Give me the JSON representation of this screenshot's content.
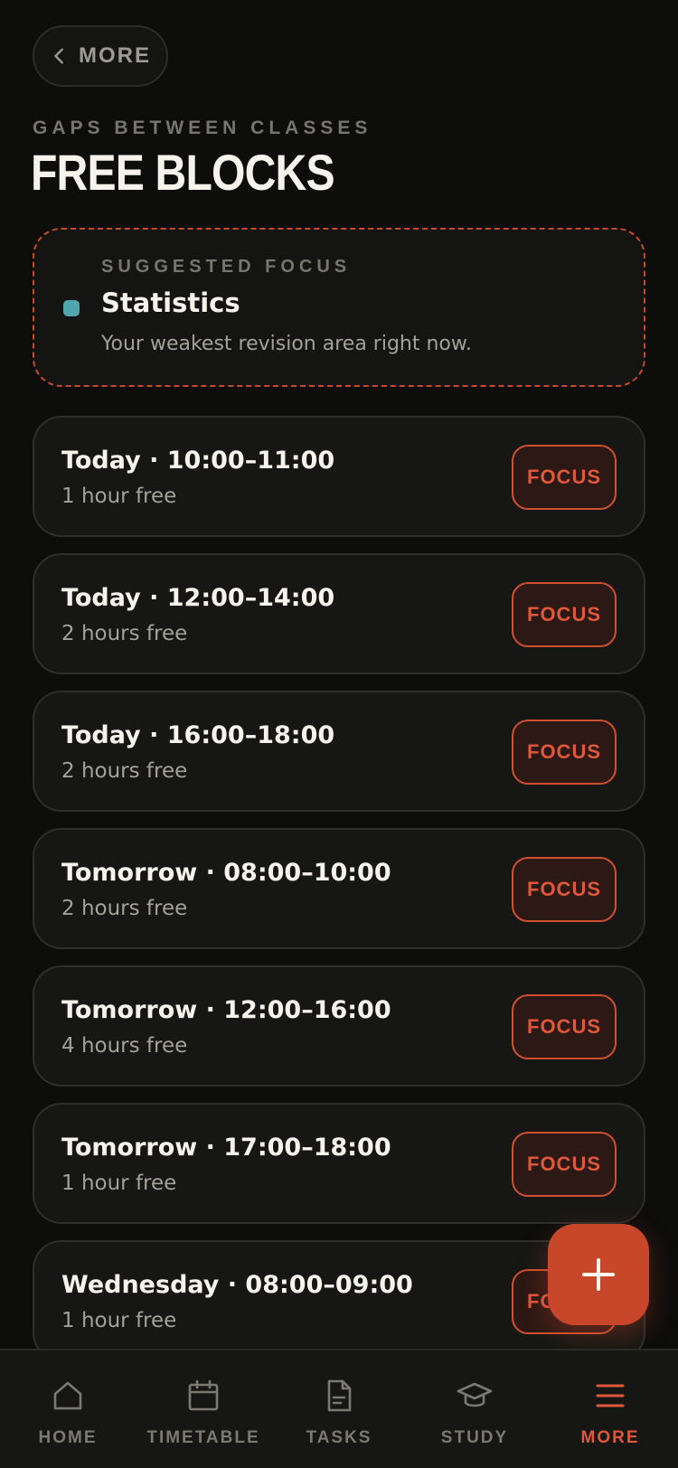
{
  "header": {
    "back_label": "MORE",
    "eyebrow": "GAPS BETWEEN CLASSES",
    "title": "FREE BLOCKS"
  },
  "suggested": {
    "eyebrow": "SUGGESTED FOCUS",
    "subject": "Statistics",
    "description": "Your weakest revision area right now.",
    "subject_color": "#4fa7ad"
  },
  "blocks": [
    {
      "when": "Today · 10:00–11:00",
      "duration": "1 hour free",
      "action": "FOCUS"
    },
    {
      "when": "Today · 12:00–14:00",
      "duration": "2 hours free",
      "action": "FOCUS"
    },
    {
      "when": "Today · 16:00–18:00",
      "duration": "2 hours free",
      "action": "FOCUS"
    },
    {
      "when": "Tomorrow · 08:00–10:00",
      "duration": "2 hours free",
      "action": "FOCUS"
    },
    {
      "when": "Tomorrow · 12:00–16:00",
      "duration": "4 hours free",
      "action": "FOCUS"
    },
    {
      "when": "Tomorrow · 17:00–18:00",
      "duration": "1 hour free",
      "action": "FOCUS"
    },
    {
      "when": "Wednesday · 08:00–09:00",
      "duration": "1 hour free",
      "action": "FOCUS"
    }
  ],
  "fab": {
    "icon": "plus-icon"
  },
  "nav": {
    "items": [
      {
        "label": "HOME",
        "icon": "home-icon"
      },
      {
        "label": "TIMETABLE",
        "icon": "calendar-icon"
      },
      {
        "label": "TASKS",
        "icon": "document-icon"
      },
      {
        "label": "STUDY",
        "icon": "graduation-cap-icon"
      },
      {
        "label": "MORE",
        "icon": "menu-icon"
      }
    ],
    "active": "MORE"
  },
  "colors": {
    "accent": "#c8472b",
    "background": "#0d0d0c",
    "card": "#161714"
  }
}
